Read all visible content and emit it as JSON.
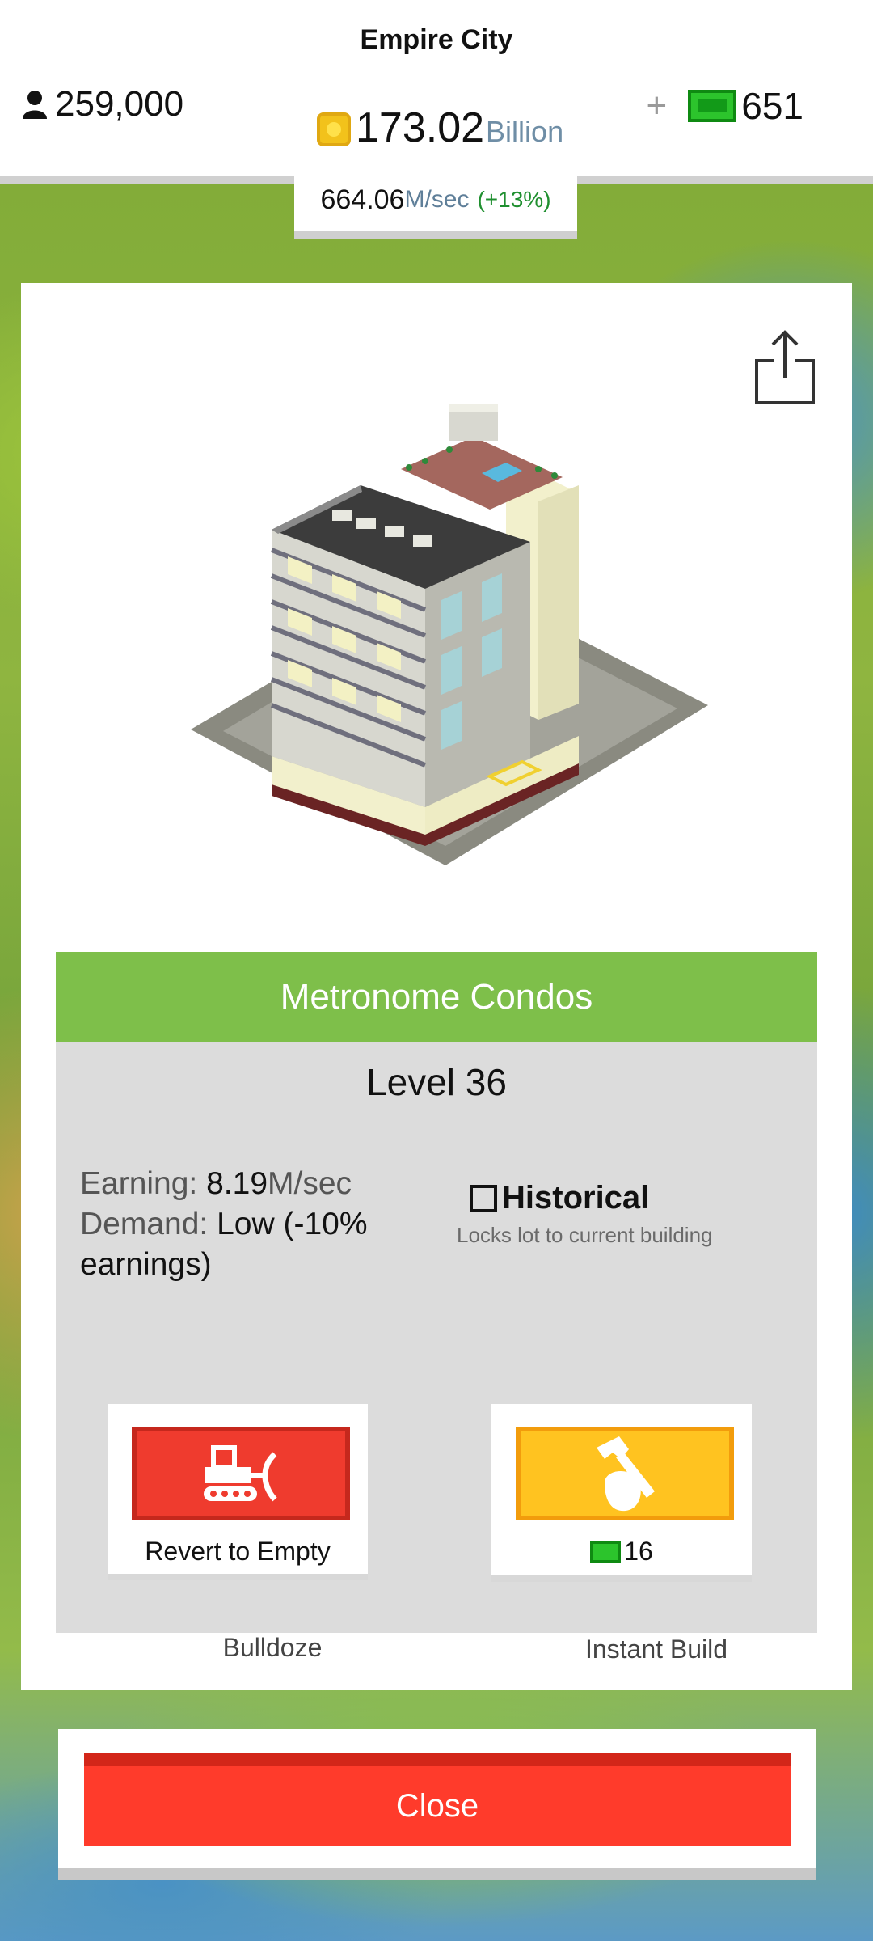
{
  "hud": {
    "city_name": "Empire City",
    "population": "259,000",
    "coins_value": "173.02",
    "coins_unit": "Billion",
    "plus": "+",
    "cash": "651",
    "rate_value": "664.06",
    "rate_unit": "M/sec",
    "rate_change": "(+13%)"
  },
  "building": {
    "name": "Metronome Condos",
    "level": "Level 36",
    "earning_label": "Earning:",
    "earning_value": "8.19",
    "earning_unit": "M/sec",
    "demand_label": "Demand:",
    "demand_value": "Low (-10% earnings)",
    "historical_label": "Historical",
    "historical_sub": "Locks lot to current building",
    "historical_checked": false
  },
  "actions": {
    "bulldoze_label": "Bulldoze",
    "bulldoze_caption": "Revert to Empty",
    "instant_label": "Instant Build",
    "instant_cost": "16"
  },
  "close_label": "Close",
  "icons": {
    "population": "person-icon",
    "coins": "coin-icon",
    "cash": "cash-icon",
    "share": "share-icon",
    "bulldoze": "bulldozer-icon",
    "build": "hammer-icon"
  },
  "colors": {
    "name_bar": "#7ebf4a",
    "bulldoze": "#ef3b2e",
    "build": "#ffc320",
    "close": "#ff3b2b",
    "cash": "#2cc42c"
  }
}
